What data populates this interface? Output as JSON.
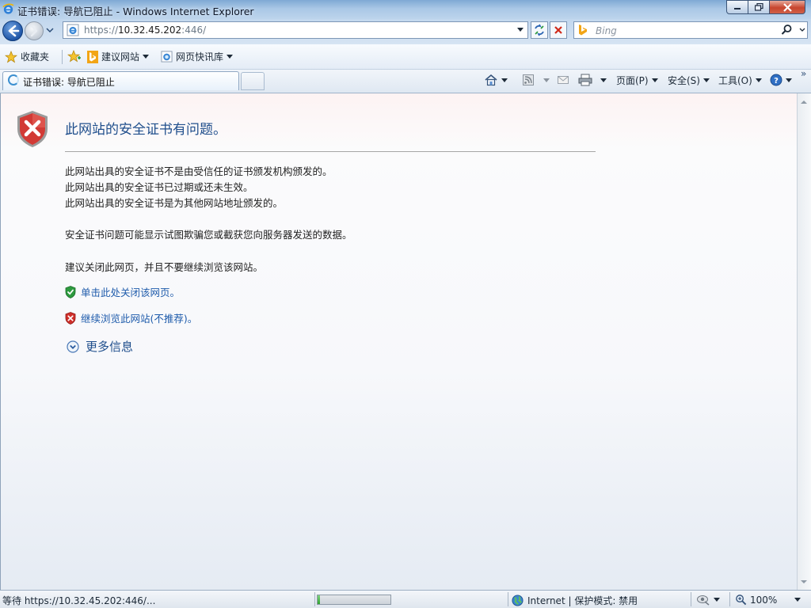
{
  "window": {
    "title": "证书错误: 导航已阻止 - Windows Internet Explorer"
  },
  "address": {
    "scheme": "https://",
    "host": "10.32.45.202",
    "rest": ":446/"
  },
  "search": {
    "placeholder": "Bing"
  },
  "favorites_bar": {
    "favorites_label": "收藏夹",
    "items": [
      {
        "label": "建议网站"
      },
      {
        "label": "网页快讯库"
      }
    ]
  },
  "tabs": [
    {
      "title": "证书错误: 导航已阻止",
      "active": true
    }
  ],
  "command_bar": {
    "page_label": "页面(P)",
    "safety_label": "安全(S)",
    "tools_label": "工具(O)"
  },
  "content": {
    "heading": "此网站的安全证书有问题。",
    "reasons": [
      "此网站出具的安全证书不是由受信任的证书颁发机构颁发的。",
      "此网站出具的安全证书已过期或还未生效。",
      "此网站出具的安全证书是为其他网站地址颁发的。"
    ],
    "warning": "安全证书问题可能显示试图欺骗您或截获您向服务器发送的数据。",
    "recommendation": "建议关闭此网页，并且不要继续浏览该网站。",
    "close_link": "单击此处关闭该网页。",
    "continue_link": "继续浏览此网站(不推荐)。",
    "more_info": "更多信息"
  },
  "status_bar": {
    "status_text": "等待 https://10.32.45.202:446/...",
    "progress": 0.03,
    "zone": "Internet | 保护模式: 禁用",
    "zoom": "100%"
  },
  "colors": {
    "link": "#1e5bab",
    "heading": "#1f4e8c",
    "error_red": "#c8242b"
  }
}
